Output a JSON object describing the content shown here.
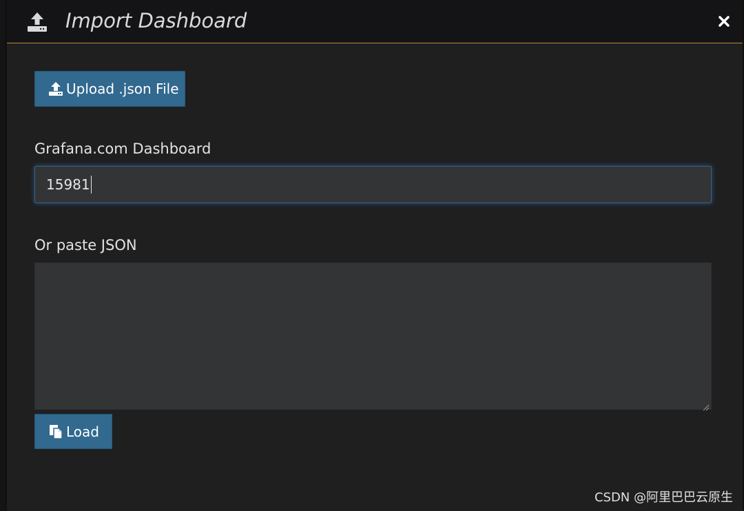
{
  "modal": {
    "title": "Import Dashboard",
    "icons": {
      "header": "upload-icon",
      "close": "close-icon"
    }
  },
  "upload": {
    "label": "Upload .json File",
    "icon": "upload-icon"
  },
  "grafana_com": {
    "label": "Grafana.com Dashboard",
    "value": "15981"
  },
  "json": {
    "label": "Or paste JSON",
    "value": ""
  },
  "load": {
    "label": "Load",
    "icon": "copy-file-icon"
  },
  "watermark": "CSDN @阿里巴巴云原生",
  "colors": {
    "button": "#31698f",
    "header_border": "#b98a3c",
    "input_focus": "#3a5f82"
  }
}
